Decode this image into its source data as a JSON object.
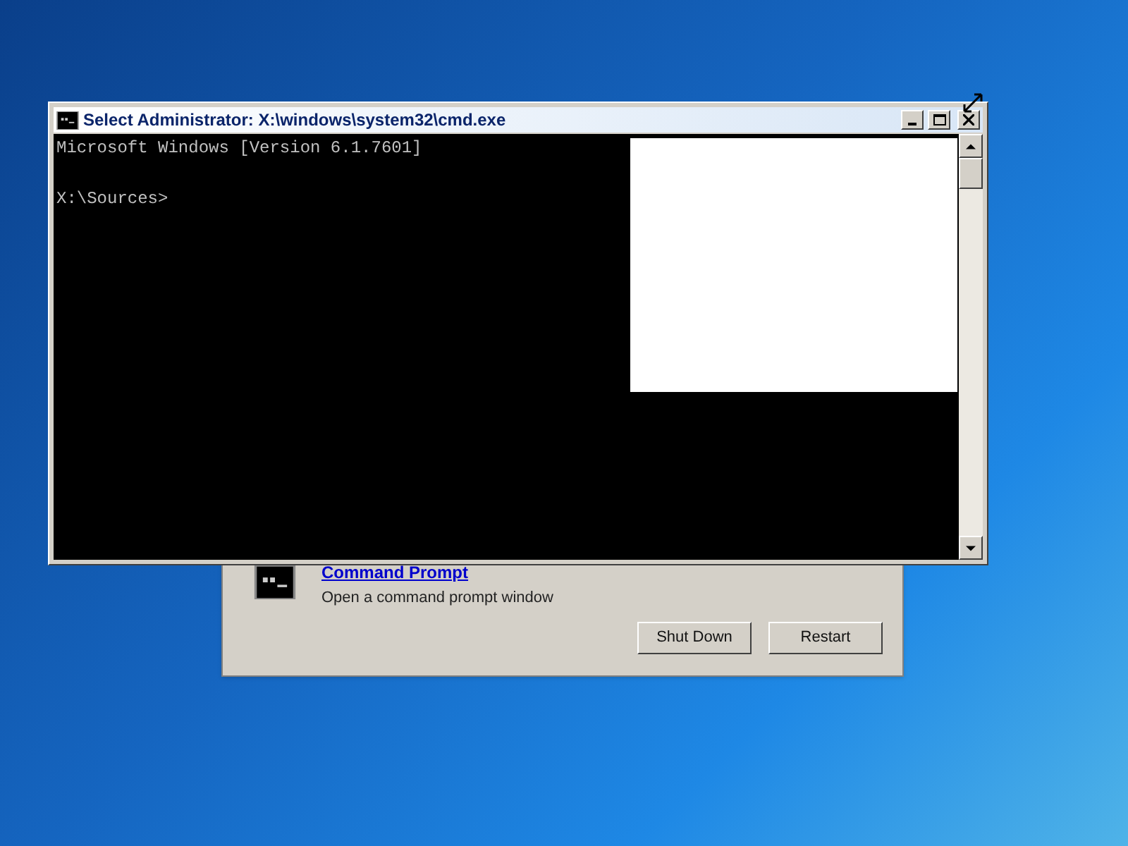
{
  "cmd_window": {
    "title": "Select Administrator: X:\\windows\\system32\\cmd.exe",
    "console_lines": [
      "Microsoft Windows [Version 6.1.7601]",
      "X:\\Sources>"
    ]
  },
  "recovery_dialog": {
    "option": {
      "title": "Command Prompt",
      "description": "Open a command prompt window"
    },
    "buttons": [
      "Shut Down",
      "Restart"
    ]
  }
}
